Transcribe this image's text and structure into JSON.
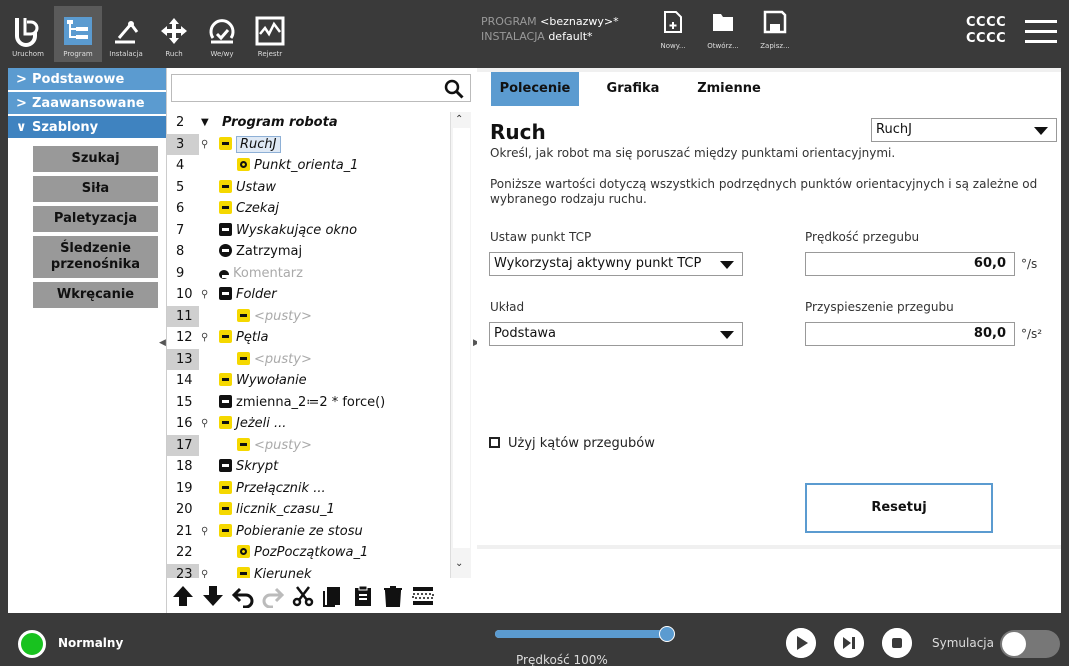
{
  "topbar": {
    "buttons": [
      {
        "label": "Uruchom",
        "icon": "ur-logo-icon"
      },
      {
        "label": "Program",
        "icon": "program-tree-icon"
      },
      {
        "label": "Instalacja",
        "icon": "robot-arm-icon"
      },
      {
        "label": "Ruch",
        "icon": "move-cross-icon"
      },
      {
        "label": "We/wy",
        "icon": "io-icon"
      },
      {
        "label": "Rejestr",
        "icon": "log-chart-icon"
      }
    ],
    "program_label": "PROGRAM",
    "program_value": "<beznazwy>*",
    "installation_label": "INSTALACJA",
    "installation_value": "default*",
    "file_buttons": [
      {
        "label": "Nowy...",
        "icon": "new-file-icon"
      },
      {
        "label": "Otwórz...",
        "icon": "open-folder-icon"
      },
      {
        "label": "Zapisz...",
        "icon": "save-icon"
      }
    ],
    "user_line1": "CCCC",
    "user_line2": "CCCC",
    "menu_icon": "hamburger-menu-icon"
  },
  "leftnav": {
    "categories": [
      {
        "label": "Podstawowe",
        "open": false
      },
      {
        "label": "Zaawansowane",
        "open": false
      },
      {
        "label": "Szablony",
        "open": true
      }
    ],
    "subitems": [
      "Szukaj",
      "Siła",
      "Paletyzacja",
      "Śledzenie przenośnika",
      "Wkręcanie"
    ]
  },
  "tree": {
    "search_placeholder": "",
    "rows": [
      {
        "line": "2",
        "text": "Program robota",
        "indent": 0
      },
      {
        "line": "3",
        "text": "RuchJ",
        "indent": 0
      },
      {
        "line": "4",
        "text": "Punkt_orienta_1",
        "indent": 1
      },
      {
        "line": "5",
        "text": "Ustaw",
        "indent": 0
      },
      {
        "line": "6",
        "text": "Czekaj",
        "indent": 0
      },
      {
        "line": "7",
        "text": "Wyskakujące okno",
        "indent": 0
      },
      {
        "line": "8",
        "text": "Zatrzymaj",
        "indent": 0
      },
      {
        "line": "9",
        "text": "Komentarz",
        "indent": 0
      },
      {
        "line": "10",
        "text": "Folder",
        "indent": 0
      },
      {
        "line": "11",
        "text": "<pusty>",
        "indent": 1
      },
      {
        "line": "12",
        "text": "Pętla",
        "indent": 0
      },
      {
        "line": "13",
        "text": "<pusty>",
        "indent": 1
      },
      {
        "line": "14",
        "text": "Wywołanie",
        "indent": 0
      },
      {
        "line": "15",
        "text": "zmienna_2≔2 * force()",
        "indent": 0
      },
      {
        "line": "16",
        "text": "Jeżeli ...",
        "indent": 0
      },
      {
        "line": "17",
        "text": "<pusty>",
        "indent": 1
      },
      {
        "line": "18",
        "text": "Skrypt",
        "indent": 0
      },
      {
        "line": "19",
        "text": "Przełącznik ...",
        "indent": 0
      },
      {
        "line": "20",
        "text": "licznik_czasu_1",
        "indent": 0
      },
      {
        "line": "21",
        "text": "Pobieranie ze stosu",
        "indent": 0
      },
      {
        "line": "22",
        "text": "PozPoczątkowa_1",
        "indent": 1
      },
      {
        "line": "23",
        "text": "Kierunek",
        "indent": 0
      }
    ],
    "tools": [
      "move-up-icon",
      "move-down-icon",
      "undo-icon",
      "redo-icon",
      "cut-icon",
      "copy-icon",
      "paste-icon",
      "delete-icon",
      "suppress-icon"
    ]
  },
  "tabs": [
    "Polecenie",
    "Grafika",
    "Zmienne"
  ],
  "command": {
    "title": "Ruch",
    "type_selected": "RuchJ",
    "description": "Określ, jak robot ma się poruszać między punktami orientacyjnymi.",
    "note": "Poniższe wartości dotyczą wszystkich podrzędnych punktów orientacyjnych i są zależne od wybranego rodzaju ruchu.",
    "tcp_label": "Ustaw punkt TCP",
    "tcp_value": "Wykorzystaj aktywny punkt TCP",
    "frame_label": "Układ",
    "frame_value": "Podstawa",
    "speed_label": "Prędkość przegubu",
    "speed_value": "60,0",
    "speed_unit": "°/s",
    "accel_label": "Przyspieszenie przegubu",
    "accel_value": "80,0",
    "accel_unit": "°/s²",
    "use_joint_angles_label": "Użyj kątów przegubów",
    "reset_label": "Resetuj"
  },
  "bottombar": {
    "status": "Normalny",
    "speed_fraction": 1.0,
    "speed_label": "Prędkość 100%",
    "sim_label": "Symulacja",
    "colors": {
      "status": "#18c21f",
      "accent": "#5b9bd0"
    }
  }
}
